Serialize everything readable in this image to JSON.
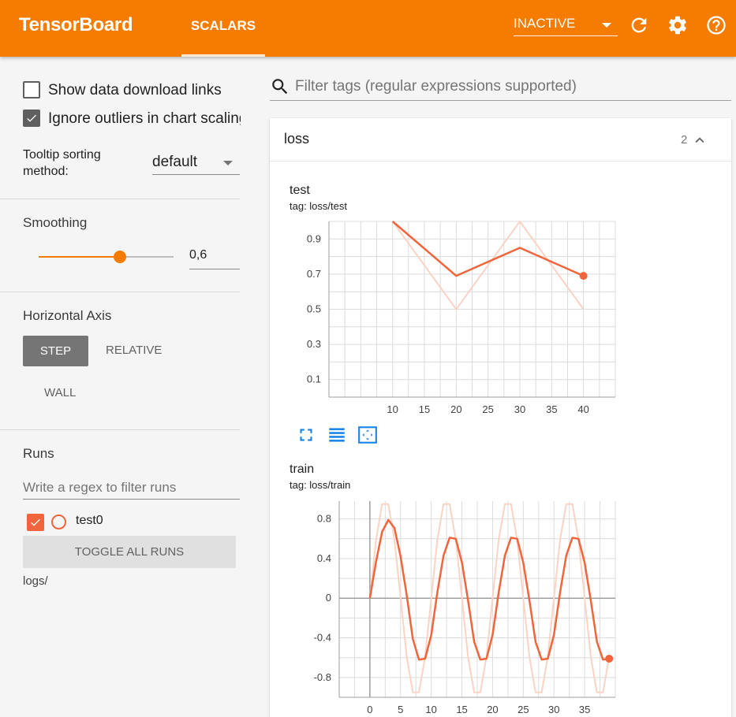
{
  "header": {
    "brand": "TensorBoard",
    "tab_scalars": "SCALARS",
    "status": "INACTIVE"
  },
  "sidebar": {
    "show_download_label": "Show data download links",
    "show_download_checked": false,
    "ignore_outliers_label": "Ignore outliers in chart scaling",
    "ignore_outliers_checked": true,
    "tooltip_label_line1": "Tooltip sorting",
    "tooltip_label_line2": "method:",
    "tooltip_value": "default",
    "smoothing_label": "Smoothing",
    "smoothing_value": "0,6",
    "smoothing_fraction": 0.6,
    "horizontal_axis_label": "Horizontal Axis",
    "axis_step": "STEP",
    "axis_relative": "RELATIVE",
    "axis_wall": "WALL",
    "runs_label": "Runs",
    "runs_filter_placeholder": "Write a regex to filter runs",
    "run_name": "test0",
    "run_checked": true,
    "toggle_all": "TOGGLE ALL RUNS",
    "logdir": "logs/"
  },
  "main": {
    "filter_placeholder": "Filter tags (regular expressions supported)",
    "card_title": "loss",
    "card_count": "2"
  },
  "colors": {
    "accent": "#f57c00",
    "series": "#f0653b",
    "series_raw": "#fbd3c5",
    "tool_icon": "#1e88e5"
  },
  "icons": {
    "refresh": "refresh-icon",
    "settings": "gear-icon",
    "help": "help-icon",
    "search": "search-icon",
    "collapse": "chevron-up-icon",
    "fullscreen": "fullscreen-icon",
    "log_scale": "lines-icon",
    "fit_domain": "fit-domain-icon"
  },
  "chart_data": [
    {
      "type": "line",
      "title": "test",
      "subtitle": "tag: loss/test",
      "xticks": [
        10,
        15,
        20,
        25,
        30,
        35,
        40
      ],
      "yticks": [
        0.1,
        0.3,
        0.5,
        0.7,
        0.9
      ],
      "xlim": [
        0,
        45
      ],
      "ylim": [
        0,
        1.0
      ],
      "grid": true,
      "series": [
        {
          "kind": "raw",
          "x": [
            10,
            20,
            30,
            40
          ],
          "y": [
            1.0,
            0.5,
            1.0,
            0.5
          ]
        },
        {
          "kind": "smoothed",
          "x": [
            10,
            20,
            30,
            40
          ],
          "y": [
            1.0,
            0.69,
            0.85,
            0.69
          ]
        }
      ]
    },
    {
      "type": "line",
      "title": "train",
      "subtitle": "tag: loss/train",
      "xticks": [
        0,
        5,
        10,
        15,
        20,
        25,
        30,
        35
      ],
      "yticks": [
        0.8,
        0.4,
        0,
        -0.4,
        -0.8
      ],
      "xlim": [
        -5,
        40
      ],
      "ylim": [
        -1.0,
        0.98
      ],
      "grid": true,
      "series": [
        {
          "kind": "raw",
          "x": [
            0,
            1,
            2,
            3,
            4,
            5,
            6,
            7,
            8,
            9,
            10,
            11,
            12,
            13,
            14,
            15,
            16,
            17,
            18,
            19,
            20,
            21,
            22,
            23,
            24,
            25,
            26,
            27,
            28,
            29,
            30,
            31,
            32,
            33,
            34,
            35,
            36,
            37,
            38,
            39
          ],
          "y": [
            0,
            0.59,
            0.95,
            0.95,
            0.59,
            0,
            -0.59,
            -0.95,
            -0.95,
            -0.59,
            0,
            0.59,
            0.95,
            0.95,
            0.59,
            0,
            -0.59,
            -0.95,
            -0.95,
            -0.59,
            0,
            0.59,
            0.95,
            0.95,
            0.59,
            0,
            -0.59,
            -0.95,
            -0.95,
            -0.59,
            0,
            0.59,
            0.95,
            0.95,
            0.59,
            0,
            -0.59,
            -0.95,
            -0.95,
            -0.59
          ]
        },
        {
          "kind": "smoothed",
          "x": [
            0,
            1,
            2,
            3,
            4,
            5,
            6,
            7,
            8,
            9,
            10,
            11,
            12,
            13,
            14,
            15,
            16,
            17,
            18,
            19,
            20,
            21,
            22,
            23,
            24,
            25,
            26,
            27,
            28,
            29,
            30,
            31,
            32,
            33,
            34,
            35,
            36,
            37,
            38,
            39
          ],
          "y": [
            0,
            0.37,
            0.67,
            0.79,
            0.71,
            0.42,
            0.03,
            -0.41,
            -0.62,
            -0.61,
            -0.37,
            0.06,
            0.43,
            0.61,
            0.6,
            0.36,
            -0.02,
            -0.44,
            -0.62,
            -0.61,
            -0.37,
            0.06,
            0.43,
            0.61,
            0.6,
            0.36,
            -0.02,
            -0.44,
            -0.62,
            -0.61,
            -0.37,
            0.06,
            0.43,
            0.61,
            0.6,
            0.36,
            -0.02,
            -0.44,
            -0.62,
            -0.61
          ]
        }
      ]
    }
  ]
}
